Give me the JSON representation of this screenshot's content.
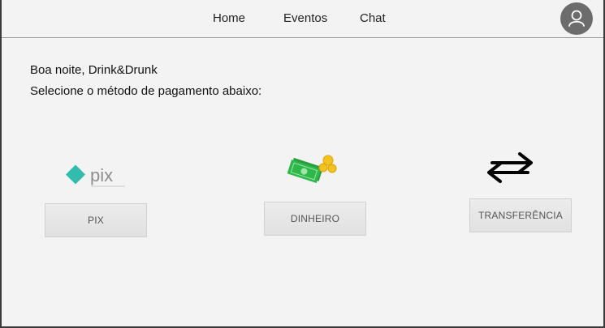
{
  "nav": {
    "links": [
      "Home",
      "Eventos",
      "Chat"
    ]
  },
  "user": {
    "avatar_icon": "user-icon"
  },
  "content": {
    "greeting": "Boa noite, Drink&Drunk",
    "instruction": "Selecione o método de pagamento abaixo:"
  },
  "payment_methods": [
    {
      "icon": "pix-logo",
      "logo_text": "pix",
      "button_label": "PIX"
    },
    {
      "icon": "money-icon",
      "button_label": "DINHEIRO"
    },
    {
      "icon": "transfer-arrows-icon",
      "button_label": "TRANSFERÊNCIA"
    }
  ],
  "colors": {
    "background": "#f3f3f3",
    "pix_teal": "#32bcad",
    "pix_gray": "#8e8e8e",
    "money_green": "#2fb84a",
    "coin_gold": "#f4c21c",
    "avatar_gray": "#6c6c6c"
  }
}
